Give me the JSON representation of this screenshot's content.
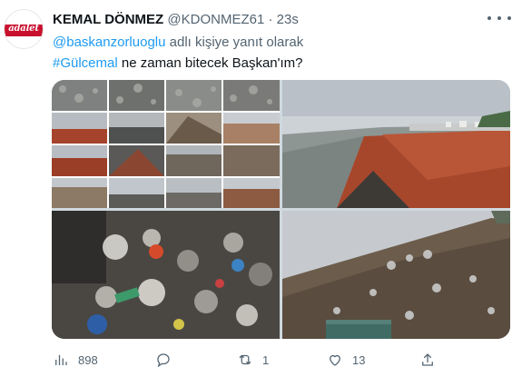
{
  "tweet": {
    "author_name": "KEMAL DÖNMEZ",
    "handle": "@KDONMEZ61",
    "separator": "·",
    "time": "23s",
    "avatar_brand": "adalet",
    "reply_to_user": "@baskanzorluoglu",
    "reply_suffix": " adlı kişiye yanıt olarak",
    "hashtag": "#Gülcemal",
    "text_rest": " ne zaman bitecek Başkan'ım?"
  },
  "media": {
    "count": 4,
    "images": [
      "rocky-shore-collage",
      "eroded-coastline-cliff",
      "garbage-pile-closeup",
      "landfill-slope"
    ]
  },
  "actions": {
    "views": "898",
    "reply": "",
    "retweets": "1",
    "likes": "13",
    "share": ""
  },
  "colors": {
    "link": "#1d9bf0",
    "text": "#0f1419",
    "secondary": "#536471",
    "brand_red": "#c8102e"
  }
}
